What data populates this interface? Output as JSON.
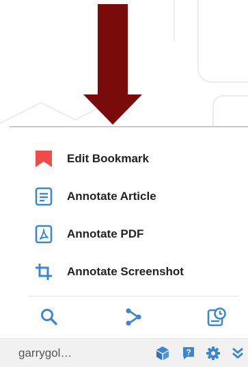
{
  "menu": {
    "items": [
      {
        "label": "Edit Bookmark",
        "icon": "bookmark-icon",
        "color": "#f04b4b"
      },
      {
        "label": "Annotate Article",
        "icon": "article-icon",
        "color": "#3a86d4"
      },
      {
        "label": "Annotate PDF",
        "icon": "pdf-icon",
        "color": "#3a86d4"
      },
      {
        "label": "Annotate Screenshot",
        "icon": "crop-icon",
        "color": "#3a86d4"
      }
    ]
  },
  "toolbar": {
    "icons": [
      "search-icon",
      "share-icon",
      "screenshot-clock-icon"
    ],
    "color": "#3a86d4"
  },
  "footer": {
    "username": "garrygol…",
    "icons": [
      "cube-icon",
      "help-icon",
      "gear-icon",
      "chevrons-down-icon"
    ],
    "color": "#3a86d4"
  },
  "arrow": {
    "color": "#7a0b0b"
  }
}
